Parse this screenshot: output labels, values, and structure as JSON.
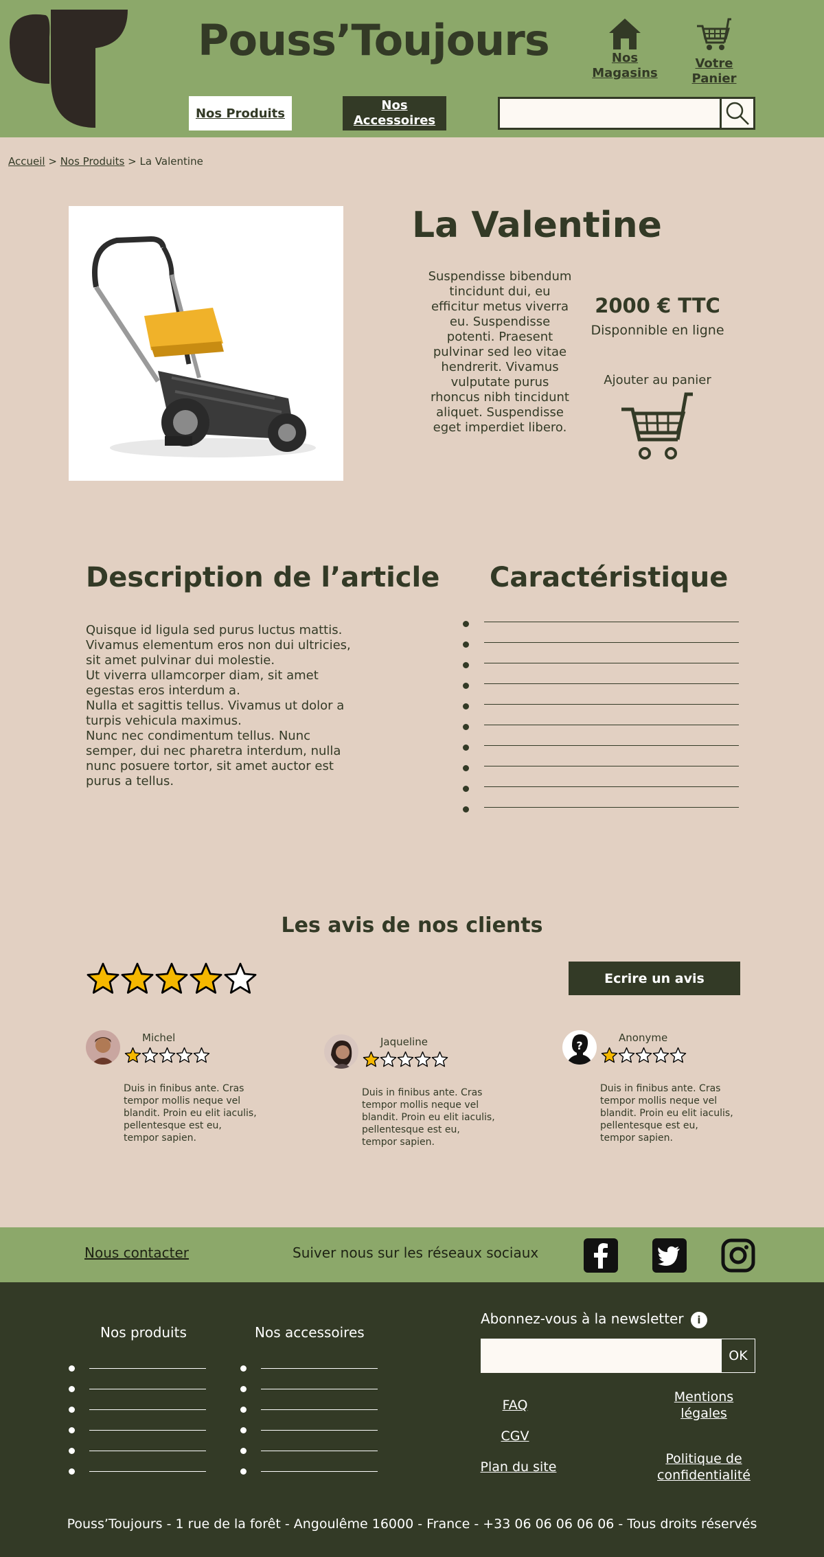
{
  "brand": {
    "name": "Pouss’Toujours",
    "logo_icon": "sprout-logo-icon"
  },
  "header": {
    "stores_label": "Nos Magasins",
    "cart_label": "Votre Panier",
    "nav_products": "Nos Produits",
    "nav_accessories": "Nos Accessoires",
    "search_value": "",
    "search_icon": "search-icon"
  },
  "breadcrumb": {
    "home": "Accueil",
    "sep1": ">",
    "products": "Nos Produits",
    "sep2": ">",
    "current": "La Valentine"
  },
  "product": {
    "name": "La Valentine",
    "short_description": "Suspendisse bibendum tincidunt dui, eu efficitur metus viverra eu. Suspendisse potenti. Praesent pulvinar sed leo vitae hendrerit. Vivamus vulputate purus rhoncus nibh tincidunt aliquet. Suspendisse eget imperdiet libero.",
    "price": "2000 € TTC",
    "availability": "Disponnible en ligne",
    "add_to_cart": "Ajouter au panier"
  },
  "article": {
    "description_title": "Description de l’article",
    "description_paragraphs": [
      "Quisque id ligula sed purus luctus mattis. Vivamus elementum eros non dui ultricies, sit amet pulvinar dui molestie.",
      "Ut viverra ullamcorper diam, sit amet egestas eros interdum a.",
      "Nulla et sagittis tellus. Vivamus ut dolor a turpis vehicula maximus.",
      "Nunc nec condimentum tellus. Nunc semper, dui nec pharetra interdum, nulla nunc posuere tortor, sit amet auctor est purus a tellus."
    ],
    "specs_title": "Caractéristique",
    "specs": [
      "",
      "",
      "",
      "",
      "",
      "",
      "",
      "",
      "",
      ""
    ]
  },
  "reviews": {
    "title": "Les avis de nos clients",
    "overall_rating": 4,
    "max_rating": 5,
    "write_button": "Ecrire un avis",
    "items": [
      {
        "name": "Michel",
        "rating": 1,
        "text": "Duis in finibus ante. Cras tempor mollis neque vel blandit. Proin eu elit iaculis, pellentesque est eu, tempor sapien."
      },
      {
        "name": "Jaqueline",
        "rating": 1,
        "text": "Duis in finibus ante. Cras tempor mollis neque vel blandit. Proin eu elit iaculis, pellentesque est eu, tempor sapien."
      },
      {
        "name": "Anonyme",
        "rating": 1,
        "text": "Duis in finibus ante. Cras tempor mollis neque vel blandit. Proin eu elit iaculis, pellentesque est eu, tempor sapien."
      }
    ]
  },
  "footer": {
    "contact": "Nous contacter",
    "social_text": "Suiver nous sur les réseaux sociaux",
    "social_icons": [
      "facebook-icon",
      "twitter-icon",
      "instagram-icon"
    ],
    "col_products": "Nos produits",
    "col_accessories": "Nos accessoires",
    "products_items": [
      "",
      "",
      "",
      "",
      "",
      ""
    ],
    "accessories_items": [
      "",
      "",
      "",
      "",
      "",
      ""
    ],
    "newsletter_label": "Abonnez-vous à la newsletter",
    "newsletter_info": "i",
    "newsletter_value": "",
    "newsletter_ok": "OK",
    "links": {
      "faq": "FAQ",
      "cgv": "CGV",
      "sitemap": "Plan du site",
      "legal": "Mentions légales",
      "privacy": "Politique de confidentialité"
    },
    "copyright": "Pouss’Toujours - 1 rue de la forêt - Angoulême 16000 - France - +33 06 06 06 06 06 - Tous droits réservés"
  },
  "colors": {
    "header_green": "#8ca86a",
    "dark_green": "#333a26",
    "background": "#e2d0c2",
    "star_yellow": "#f5b800"
  }
}
